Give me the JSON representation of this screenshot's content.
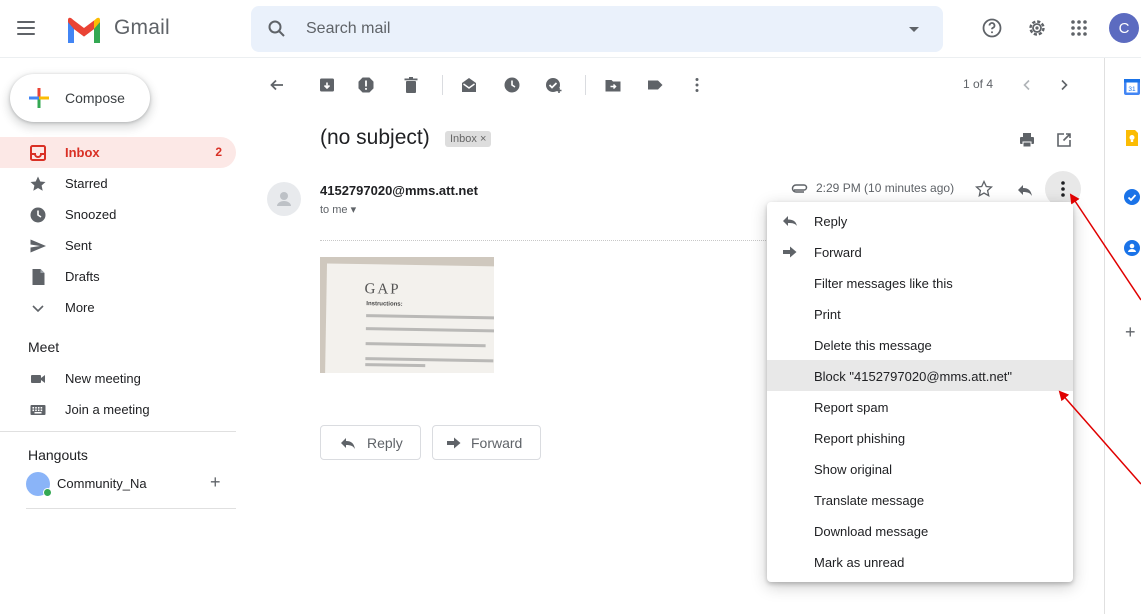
{
  "header": {
    "brand": "Gmail",
    "search_placeholder": "Search mail",
    "avatar_letter": "C"
  },
  "sidebar": {
    "compose": "Compose",
    "items": [
      {
        "label": "Inbox",
        "count": "2",
        "icon": "inbox-icon"
      },
      {
        "label": "Starred",
        "icon": "star-icon"
      },
      {
        "label": "Snoozed",
        "icon": "clock-icon"
      },
      {
        "label": "Sent",
        "icon": "send-icon"
      },
      {
        "label": "Drafts",
        "icon": "draft-icon"
      },
      {
        "label": "More",
        "icon": "chevron-down-icon"
      }
    ],
    "meet": {
      "heading": "Meet",
      "items": [
        {
          "label": "New meeting",
          "icon": "video-icon"
        },
        {
          "label": "Join a meeting",
          "icon": "keyboard-icon"
        }
      ]
    },
    "hangouts": {
      "heading": "Hangouts",
      "user": "Community_Na",
      "add": "+"
    }
  },
  "toolbar": {
    "pager": "1 of 4"
  },
  "message": {
    "subject": "(no subject)",
    "label_chip": "Inbox ×",
    "sender": "4152797020@mms.att.net",
    "recipient": "to me",
    "time": "2:29 PM (10 minutes ago)",
    "attachment": {
      "heading": "GAP",
      "caption": "Instructions:"
    },
    "reply_button": "Reply",
    "forward_button": "Forward"
  },
  "menu": {
    "items": [
      {
        "label": "Reply",
        "icon": "reply-icon"
      },
      {
        "label": "Forward",
        "icon": "forward-icon"
      },
      {
        "label": "Filter messages like this"
      },
      {
        "label": "Print"
      },
      {
        "label": "Delete this message"
      },
      {
        "label": "Block \"4152797020@mms.att.net\"",
        "highlighted": true
      },
      {
        "label": "Report spam"
      },
      {
        "label": "Report phishing"
      },
      {
        "label": "Show original"
      },
      {
        "label": "Translate message"
      },
      {
        "label": "Download message"
      },
      {
        "label": "Mark as unread"
      }
    ]
  },
  "right_panel": {
    "add": "+"
  },
  "colors": {
    "accent_red": "#d93025",
    "annotation_arrow": "#e00000",
    "menu_highlight": "#e8e8e8"
  }
}
